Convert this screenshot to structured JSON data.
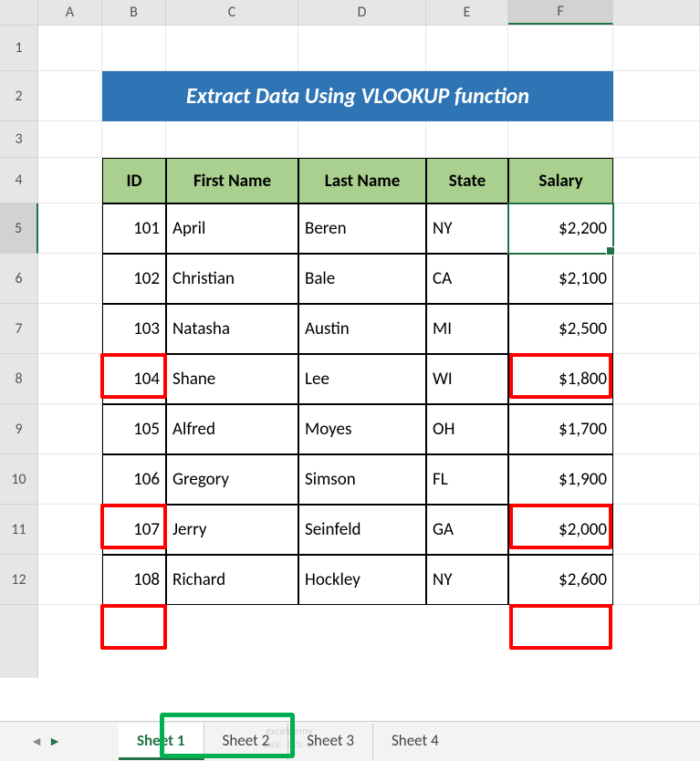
{
  "columns": [
    "A",
    "B",
    "C",
    "D",
    "E",
    "F"
  ],
  "rows": [
    "1",
    "2",
    "3",
    "4",
    "5",
    "6",
    "7",
    "8",
    "9",
    "10",
    "11",
    "12"
  ],
  "title": "Extract Data Using VLOOKUP function",
  "headers": {
    "id": "ID",
    "first": "First Name",
    "last": "Last Name",
    "state": "State",
    "salary": "Salary"
  },
  "chart_data": {
    "type": "table",
    "title": "Extract Data Using VLOOKUP function",
    "columns": [
      "ID",
      "First Name",
      "Last Name",
      "State",
      "Salary"
    ],
    "rows": [
      {
        "id": 101,
        "first": "April",
        "last": "Beren",
        "state": "NY",
        "salary": 2200
      },
      {
        "id": 102,
        "first": "Christian",
        "last": "Bale",
        "state": "CA",
        "salary": 2100
      },
      {
        "id": 103,
        "first": "Natasha",
        "last": "Austin",
        "state": "MI",
        "salary": 2500
      },
      {
        "id": 104,
        "first": "Shane",
        "last": "Lee",
        "state": "WI",
        "salary": 1800
      },
      {
        "id": 105,
        "first": "Alfred",
        "last": "Moyes",
        "state": "OH",
        "salary": 1700
      },
      {
        "id": 106,
        "first": "Gregory",
        "last": "Simson",
        "state": "FL",
        "salary": 1900
      },
      {
        "id": 107,
        "first": "Jerry",
        "last": "Seinfeld",
        "state": "GA",
        "salary": 2000
      },
      {
        "id": 108,
        "first": "Richard",
        "last": "Hockley",
        "state": "NY",
        "salary": 2600
      }
    ]
  },
  "data": [
    {
      "id": "101",
      "first": "April",
      "last": "Beren",
      "state": "NY",
      "salary": "$2,200"
    },
    {
      "id": "102",
      "first": "Christian",
      "last": "Bale",
      "state": "CA",
      "salary": "$2,100"
    },
    {
      "id": "103",
      "first": "Natasha",
      "last": "Austin",
      "state": "MI",
      "salary": "$2,500"
    },
    {
      "id": "104",
      "first": "Shane",
      "last": "Lee",
      "state": "WI",
      "salary": "$1,800"
    },
    {
      "id": "105",
      "first": "Alfred",
      "last": "Moyes",
      "state": "OH",
      "salary": "$1,700"
    },
    {
      "id": "106",
      "first": "Gregory",
      "last": "Simson",
      "state": "FL",
      "salary": "$1,900"
    },
    {
      "id": "107",
      "first": "Jerry",
      "last": "Seinfeld",
      "state": "GA",
      "salary": "$2,000"
    },
    {
      "id": "108",
      "first": "Richard",
      "last": "Hockley",
      "state": "NY",
      "salary": "$2,600"
    }
  ],
  "tabs": [
    "Sheet 1",
    "Sheet 2",
    "Sheet 3",
    "Sheet 4"
  ],
  "active_tab": 0,
  "selected_cell": "F5",
  "nav": {
    "prev": "◄",
    "next": "►"
  },
  "watermark": {
    "brand": "e",
    "name": "exceldemy",
    "tag": "EXCEL · DATA · BI"
  }
}
